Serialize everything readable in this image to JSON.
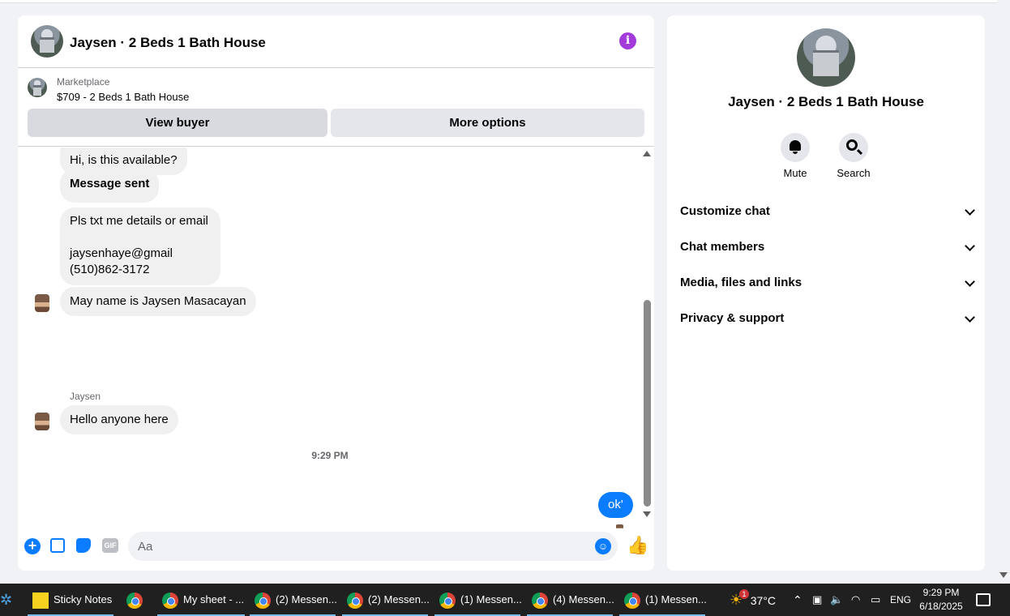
{
  "chat": {
    "title": "Jaysen · 2 Beds 1 Bath House",
    "listing": {
      "source": "Marketplace",
      "price_title": "$709 - 2 Beds 1 Bath House"
    },
    "buttons": {
      "view_buyer": "View buyer",
      "more_options": "More options"
    },
    "messages": [
      {
        "text": "Hi, is this available?"
      },
      {
        "text": "Message sent"
      },
      {
        "text": "Pls txt me details or email\n\njaysenhaye@gmail\n(510)862-3172"
      },
      {
        "text": "May name is Jaysen Masacayan"
      },
      {
        "sender": "Jaysen",
        "text": "Hello anyone here"
      }
    ],
    "timestamp": "9:29 PM",
    "my_message": "ok'",
    "composer": {
      "placeholder": "Aa",
      "gif_label": "GIF"
    }
  },
  "info_panel": {
    "title": "Jaysen · 2 Beds 1 Bath House",
    "actions": [
      {
        "label": "Mute",
        "icon": "bell-icon"
      },
      {
        "label": "Search",
        "icon": "search-icon"
      }
    ],
    "sections": [
      "Customize chat",
      "Chat members",
      "Media, files and links",
      "Privacy & support"
    ]
  },
  "taskbar": {
    "items": [
      {
        "label": "Sticky Notes"
      },
      {
        "label": "My sheet - ..."
      },
      {
        "label": "(2) Messen..."
      },
      {
        "label": "(2) Messen..."
      },
      {
        "label": "(1) Messen..."
      },
      {
        "label": "(4) Messen..."
      },
      {
        "label": "(1) Messen..."
      }
    ],
    "weather": "37°C",
    "weather_badge": "1",
    "language": "ENG",
    "time": "9:29 PM",
    "date": "6/18/2025"
  },
  "colors": {
    "accent": "#0a7cff",
    "info_icon": "#a33bdb",
    "taskbar": "#202020"
  }
}
